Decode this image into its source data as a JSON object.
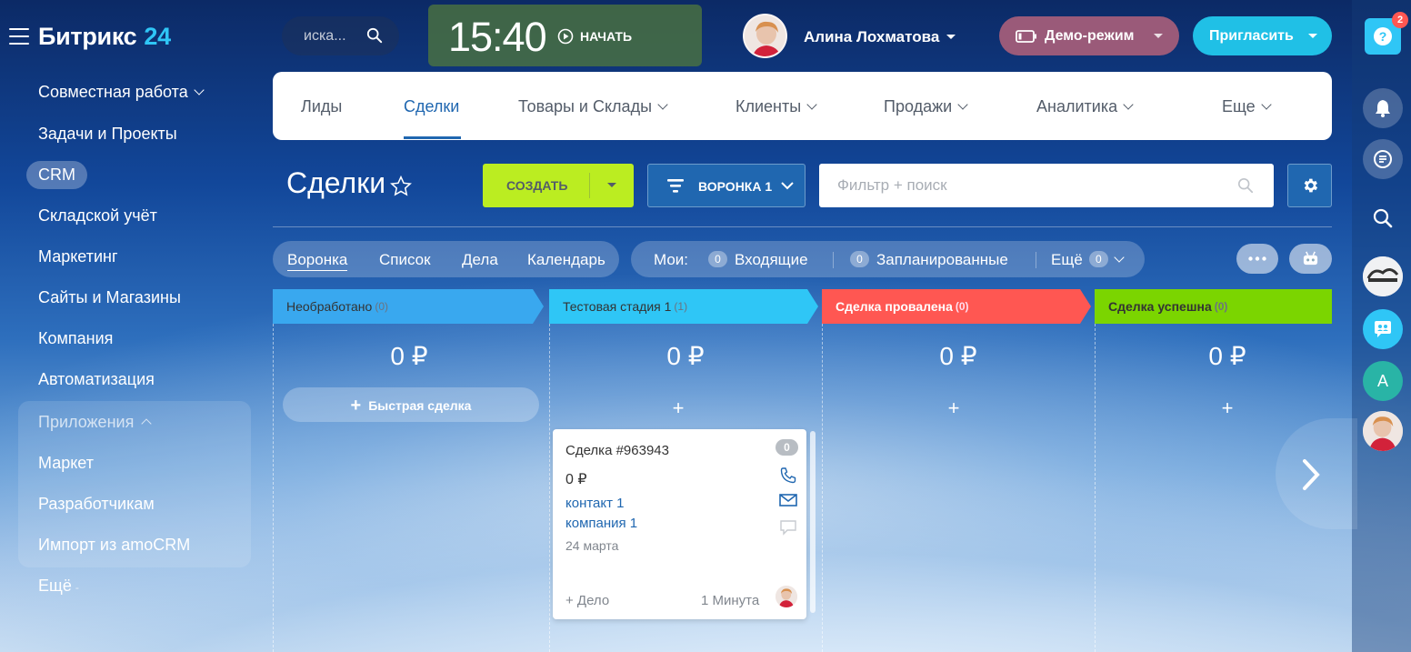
{
  "app": {
    "logo_text": "Битрикс",
    "logo_num": "24"
  },
  "left_menu": {
    "items": [
      "Совместная работа",
      "Задачи и Проекты",
      "CRM",
      "Складской учёт",
      "Маркетинг",
      "Сайты и Магазины",
      "Компания",
      "Автоматизация"
    ],
    "apps_title": "Приложения",
    "apps_items": [
      "Маркет",
      "Разработчикам",
      "Импорт из amoCRM"
    ],
    "more": "Ещё"
  },
  "header": {
    "search_placeholder": "иска...",
    "clock": "15:40",
    "start_label": "НАЧАТЬ",
    "user_name": "Алина Лохматова",
    "demo_label": "Демо-режим",
    "invite_label": "Пригласить",
    "help_badge": "2"
  },
  "nav": {
    "tabs": [
      "Лиды",
      "Сделки",
      "Товары и Склады",
      "Клиенты",
      "Продажи",
      "Аналитика",
      "Еще"
    ],
    "active": "Сделки"
  },
  "toolbar": {
    "title": "Сделки",
    "create_label": "СОЗДАТЬ",
    "funnel_label": "ВОРОНКА 1",
    "filter_placeholder": "Фильтр + поиск"
  },
  "views": {
    "items": [
      "Воронка",
      "Список",
      "Дела",
      "Календарь"
    ],
    "active": "Воронка",
    "mine_label": "Мои:",
    "incoming_count": "0",
    "incoming_label": "Входящие",
    "planned_count": "0",
    "planned_label": "Запланированные",
    "more_label": "Ещё",
    "more_count": "0"
  },
  "stages": [
    {
      "name": "Необработано",
      "count": "(0)",
      "sum": "0 ₽",
      "color": "#39a8ef"
    },
    {
      "name": "Тестовая стадия 1",
      "count": "(1)",
      "sum": "0 ₽",
      "color": "#2fc6f6"
    },
    {
      "name": "Сделка провалена",
      "count": "(0)",
      "sum": "0 ₽",
      "color": "#ff5752"
    },
    {
      "name": "Сделка успешна",
      "count": "(0)",
      "sum": "0 ₽",
      "color": "#7bd500"
    }
  ],
  "quick_deal_label": "Быстрая сделка",
  "card": {
    "title": "Сделка #963943",
    "activity_count": "0",
    "price": "0 ₽",
    "contact": "контакт 1",
    "company": "компания 1",
    "date": "24 марта",
    "add_task": "+ Дело",
    "time_ago": "1 Минута"
  },
  "right_panel": {
    "avatar_letter": "A"
  }
}
